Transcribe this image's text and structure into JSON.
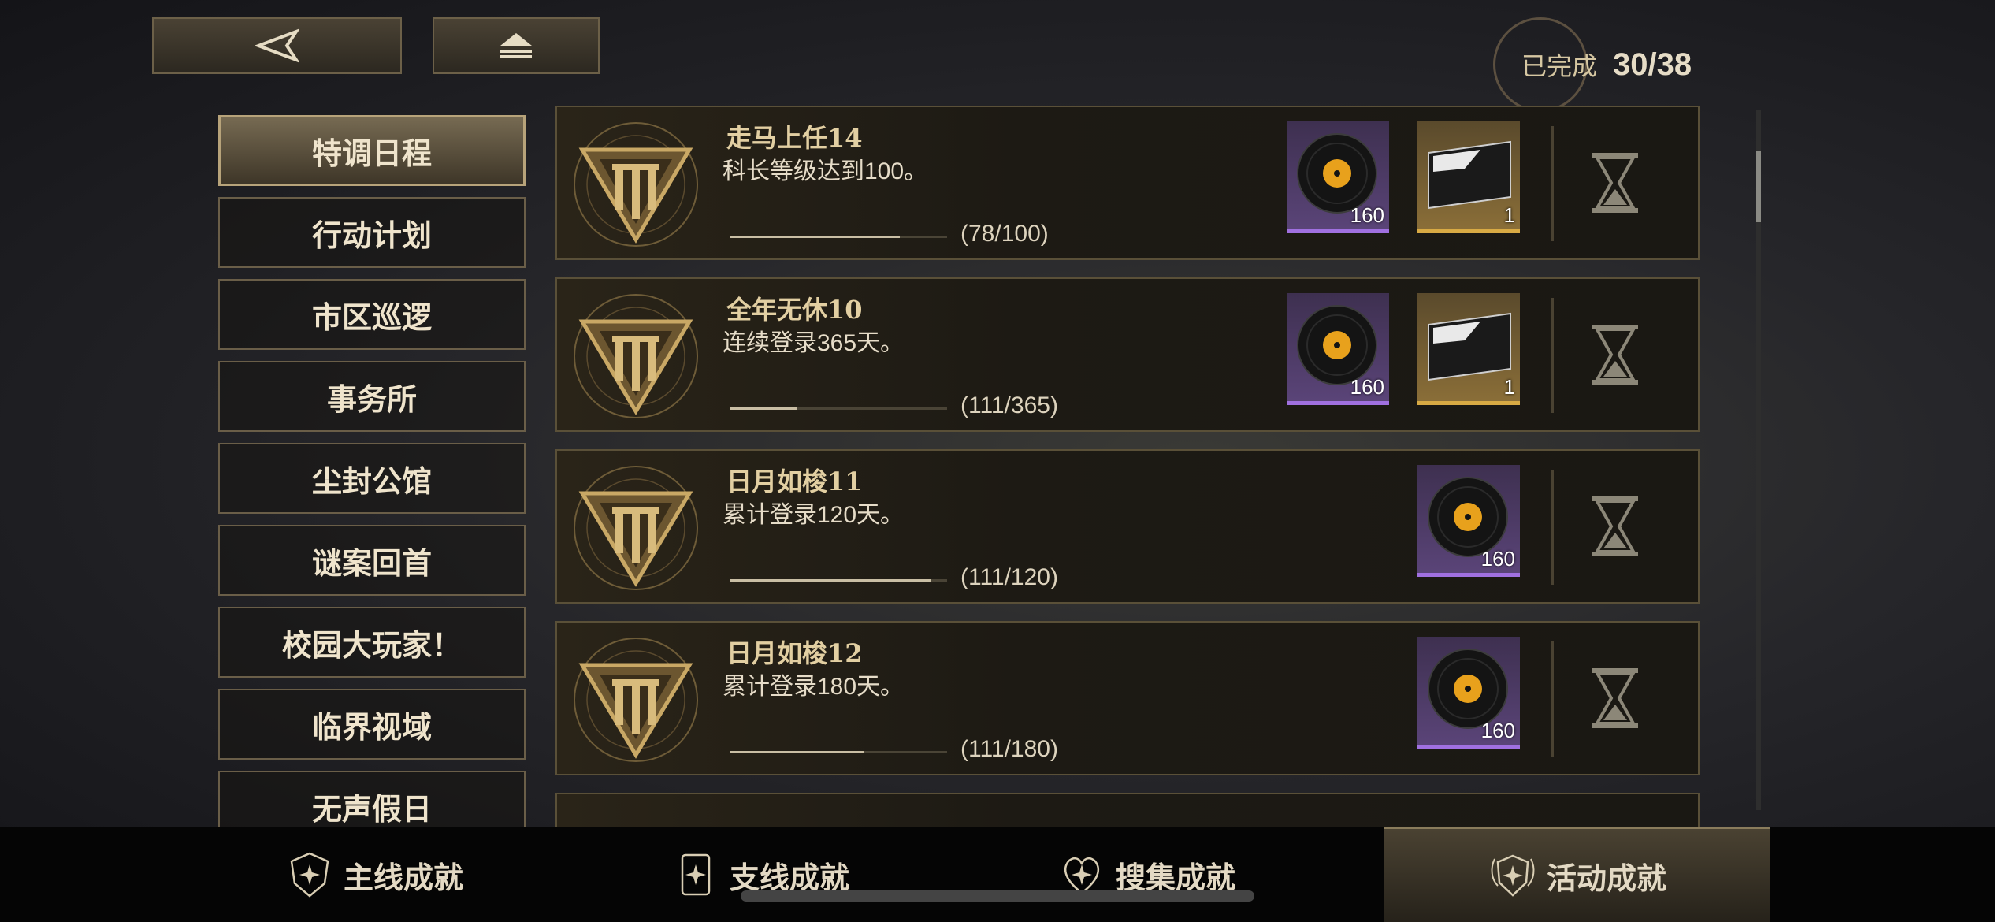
{
  "completion": {
    "label": "已完成",
    "value": "30/38"
  },
  "sidebar": {
    "items": [
      {
        "label": "特调日程",
        "active": true
      },
      {
        "label": "行动计划",
        "active": false
      },
      {
        "label": "市区巡逻",
        "active": false
      },
      {
        "label": "事务所",
        "active": false
      },
      {
        "label": "尘封公馆",
        "active": false
      },
      {
        "label": "谜案回首",
        "active": false
      },
      {
        "label": "校园大玩家！",
        "active": false
      },
      {
        "label": "临界视域",
        "active": false
      },
      {
        "label": "无声假日",
        "active": false
      }
    ]
  },
  "achievements": [
    {
      "title": "走马上任14",
      "desc": "科长等级达到100。",
      "progress_text": "(78/100)",
      "progress": 0.78,
      "rewards": [
        {
          "type": "record-disc",
          "qty": "160"
        },
        {
          "type": "ticket",
          "qty": "1"
        }
      ]
    },
    {
      "title": "全年无休10",
      "desc": "连续登录365天。",
      "progress_text": "(111/365)",
      "progress": 0.304,
      "rewards": [
        {
          "type": "record-disc",
          "qty": "160"
        },
        {
          "type": "ticket",
          "qty": "1"
        }
      ]
    },
    {
      "title": "日月如梭11",
      "desc": "累计登录120天。",
      "progress_text": "(111/120)",
      "progress": 0.925,
      "rewards": [
        {
          "type": "record-disc",
          "qty": "160"
        }
      ]
    },
    {
      "title": "日月如梭12",
      "desc": "累计登录180天。",
      "progress_text": "(111/180)",
      "progress": 0.617,
      "rewards": [
        {
          "type": "record-disc",
          "qty": "160"
        }
      ]
    }
  ],
  "bottom_tabs": [
    {
      "label": "主线成就",
      "icon": "shield-star-icon",
      "active": false
    },
    {
      "label": "支线成就",
      "icon": "scroll-star-icon",
      "active": false
    },
    {
      "label": "搜集成就",
      "icon": "heart-star-icon",
      "active": false
    },
    {
      "label": "活动成就",
      "icon": "winged-star-icon",
      "active": true
    }
  ],
  "icons": {
    "back": "back-arrow-icon",
    "home": "eject-icon",
    "status": "hourglass-icon"
  },
  "colors": {
    "accent_gold": "#c9a865",
    "record_purple": "#a070e0",
    "ticket_gold": "#d8aa44"
  }
}
